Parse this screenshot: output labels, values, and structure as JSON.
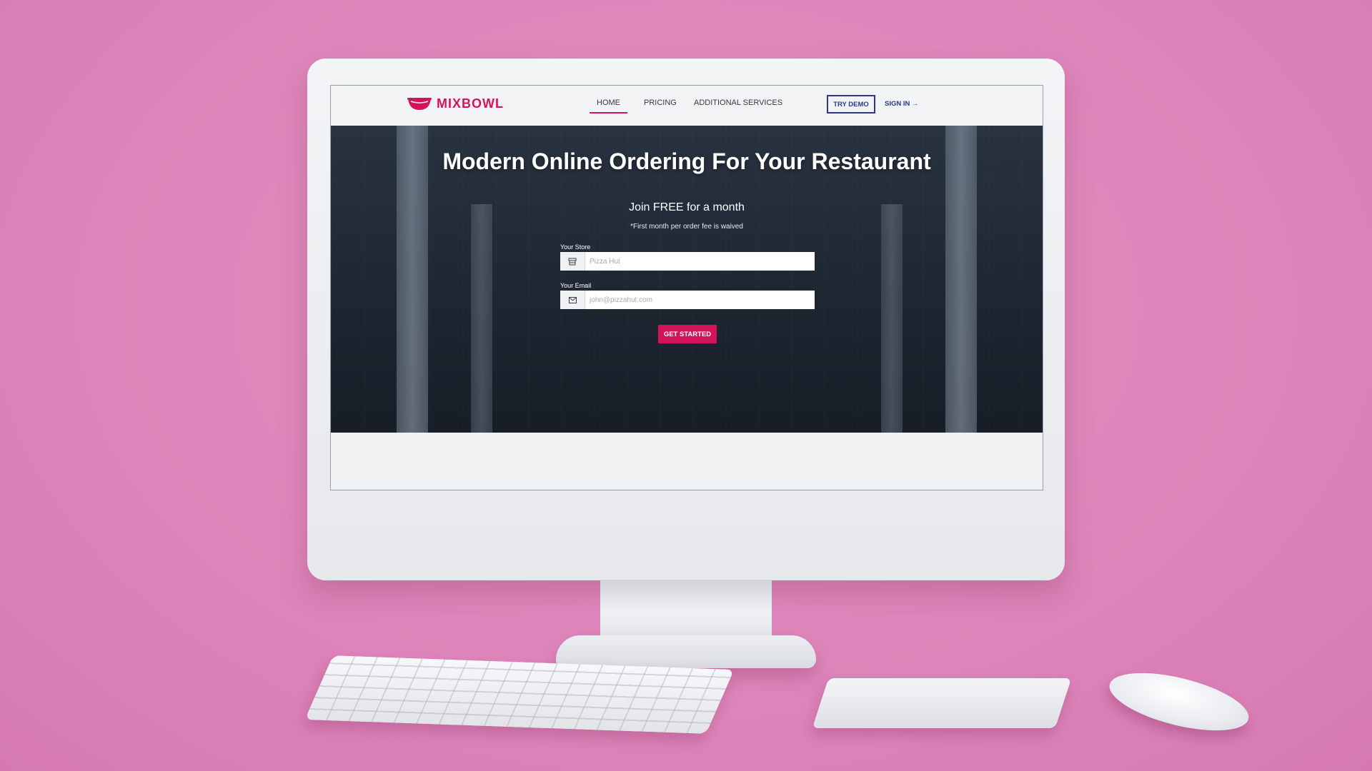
{
  "brand": {
    "name": "MIXBOWL",
    "accent_color": "#d4145a",
    "secondary_color": "#2a3a8a",
    "logo_icon": "bowl-icon"
  },
  "nav": {
    "items": [
      {
        "label": "HOME",
        "active": true
      },
      {
        "label": "PRICING",
        "active": false
      },
      {
        "label": "ADDITIONAL SERVICES",
        "active": false
      }
    ],
    "try_demo_label": "TRY DEMO",
    "sign_in_label": "SIGN IN →"
  },
  "hero": {
    "title": "Modern Online Ordering For Your Restaurant",
    "subtitle": "Join FREE for a month",
    "note": "*First month per order fee is waived",
    "form": {
      "store": {
        "label": "Your Store",
        "placeholder": "Pizza Hut",
        "value": "",
        "icon": "store-icon"
      },
      "email": {
        "label": "Your Email",
        "placeholder": "john@pizzahut.com",
        "value": "",
        "icon": "envelope-icon"
      },
      "submit_label": "GET STARTED"
    }
  }
}
